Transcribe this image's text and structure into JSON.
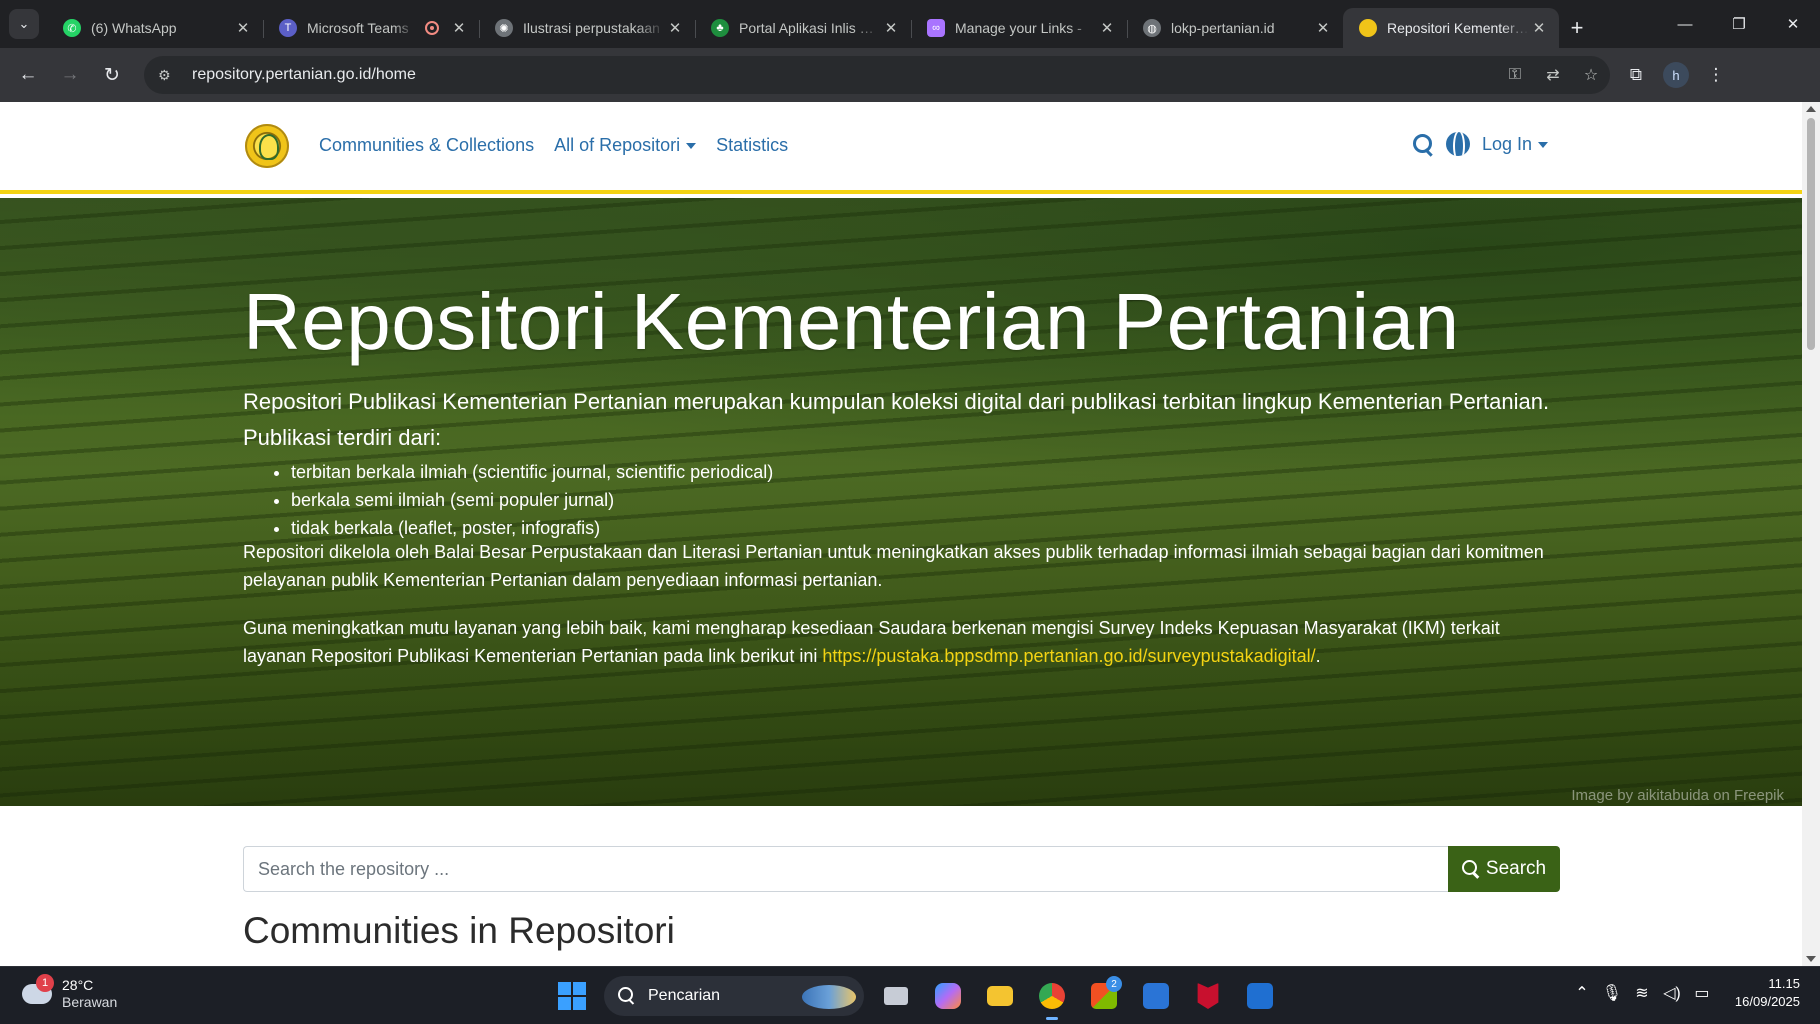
{
  "browser": {
    "tabs": [
      {
        "title": "(6) WhatsApp",
        "favicon_color": "#25d366",
        "icon": "whatsapp-icon",
        "active": false
      },
      {
        "title": "Microsoft Teams",
        "favicon_color": "#5b5fc7",
        "icon": "teams-icon",
        "active": false,
        "recording": true
      },
      {
        "title": "Ilustrasi perpustakaan",
        "favicon_color": "#9aa0a6",
        "icon": "openai-icon",
        "active": false
      },
      {
        "title": "Portal Aplikasi Inlis Lite",
        "favicon_color": "#1e8e3e",
        "icon": "portal-icon",
        "active": false
      },
      {
        "title": "Manage your Links - ",
        "favicon_color": "#a974ff",
        "icon": "links-icon",
        "active": false
      },
      {
        "title": "lokp-pertanian.id",
        "favicon_color": "#9aa0a6",
        "icon": "globe-icon",
        "active": false
      },
      {
        "title": "Repositori Kementerian",
        "favicon_color": "#f0c419",
        "icon": "kementan-icon",
        "active": true
      }
    ],
    "url": "repository.pertanian.go.id/home",
    "profile_initial": "h"
  },
  "site": {
    "nav": {
      "communities": "Communities & Collections",
      "all": "All of Repositori",
      "statistics": "Statistics",
      "login": "Log In"
    },
    "hero": {
      "title": "Repositori Kementerian Pertanian",
      "lead": "Repositori Publikasi Kementerian Pertanian merupakan kumpulan koleksi digital dari publikasi terbitan lingkup Kementerian Pertanian. Publikasi terdiri dari:",
      "list": [
        "terbitan berkala ilmiah (scientific journal, scientific periodical)",
        "berkala semi ilmiah (semi populer jurnal)",
        "tidak berkala (leaflet, poster, infografis)"
      ],
      "p2": "Repositori dikelola oleh Balai Besar Perpustakaan dan Literasi Pertanian untuk meningkatkan akses publik terhadap informasi ilmiah sebagai bagian dari komitmen pelayanan publik Kementerian Pertanian dalam penyediaan informasi pertanian.",
      "p3": "Guna meningkatkan mutu layanan yang lebih baik, kami mengharap kesediaan Saudara berkenan mengisi Survey Indeks Kepuasan Masyarakat (IKM) terkait layanan Repositori Publikasi Kementerian Pertanian pada link berikut ini ",
      "p3_link": "https://pustaka.bppsdmp.pertanian.go.id/surveypustakadigital/",
      "p3_end": ".",
      "credit": "Image by aikitabuida on Freepik"
    },
    "search": {
      "placeholder": "Search the repository ...",
      "button": "Search"
    },
    "communities_title": "Communities in Repositori"
  },
  "taskbar": {
    "weather": {
      "temp": "28°C",
      "condition": "Berawan",
      "badge": "1"
    },
    "search_placeholder": "Pencarian",
    "apps": [
      {
        "name": "task-view-icon",
        "color": "#c7ccd6"
      },
      {
        "name": "copilot-icon",
        "color": "#b36cf5"
      },
      {
        "name": "file-explorer-icon",
        "color": "#f4c430"
      },
      {
        "name": "chrome-icon",
        "color": "#e94235",
        "active": true
      },
      {
        "name": "store-icon",
        "color": "#3a8ee6",
        "badge": "2"
      },
      {
        "name": "vscode-like-icon",
        "color": "#2a74d6"
      },
      {
        "name": "mcafee-icon",
        "color": "#c8102e"
      },
      {
        "name": "outlook-icon",
        "color": "#1f6fd1"
      }
    ],
    "time": "11.15",
    "date": "16/09/2025"
  }
}
